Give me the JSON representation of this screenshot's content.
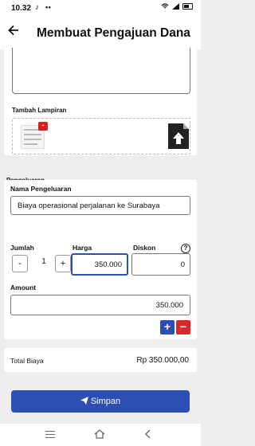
{
  "status_bar": {
    "time": "10.32",
    "notif_icons": "♪",
    "dots": "• •"
  },
  "header": {
    "title": "Membuat Pengajuan Dana",
    "back_icon": "arrow-left-icon"
  },
  "attachments": {
    "label": "Tambah Lampiran",
    "delete_badge": "-"
  },
  "expenses": {
    "section_label": "Pengeluaran",
    "name_label": "Nama Pengeluaran",
    "name_value": "Biaya operasional perjalanan ke Surabaya",
    "qty_label": "Jumlah",
    "qty_value": "1",
    "minus": "-",
    "plus": "+",
    "price_label": "Harga",
    "price_value": "350.000",
    "discount_label": "Diskon",
    "discount_value": "0",
    "amount_label": "Amount",
    "amount_value": "350.000",
    "help": "?"
  },
  "row_actions": {
    "add": "+",
    "remove": "−"
  },
  "total": {
    "label": "Total Biaya",
    "value": "Rp 350.000,00"
  },
  "save_button": {
    "label": "Simpan"
  },
  "colors": {
    "primary": "#2d4fb3",
    "danger": "#e0262a"
  }
}
